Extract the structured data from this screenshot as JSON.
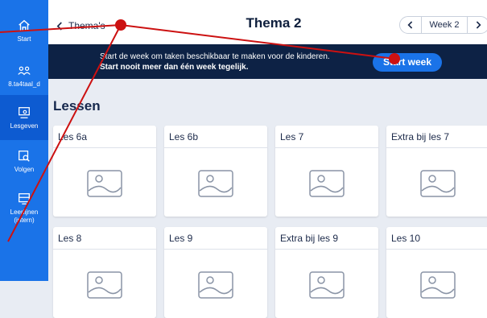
{
  "sidebar": {
    "items": [
      {
        "label": "Start",
        "icon": "home-icon"
      },
      {
        "label": "8.ta4taal_d",
        "icon": "group-icon"
      },
      {
        "label": "Lesgeven",
        "icon": "teach-icon"
      },
      {
        "label": "Volgen",
        "icon": "track-icon"
      },
      {
        "label": "Leerlijnen (intern)",
        "icon": "learning-lines-icon"
      }
    ]
  },
  "header": {
    "back_label": "Thema's",
    "title": "Thema 2",
    "week_label": "Week 2"
  },
  "banner": {
    "line1": "Start de week om taken beschikbaar te maken voor de kinderen.",
    "line2": "Start nooit meer dan één week tegelijk.",
    "button_label": "Start week"
  },
  "lessons": {
    "title": "Lessen",
    "cards": [
      "Les 6a",
      "Les 6b",
      "Les 7",
      "Extra bij les 7",
      "Les 8",
      "Les 9",
      "Extra bij les 9",
      "Les 10"
    ]
  },
  "colors": {
    "sidebar": "#1a73e8",
    "sidebar_active": "#0d5bd1",
    "banner": "#0d2245",
    "accent": "#1a73e8",
    "annotation": "#cc1111"
  }
}
